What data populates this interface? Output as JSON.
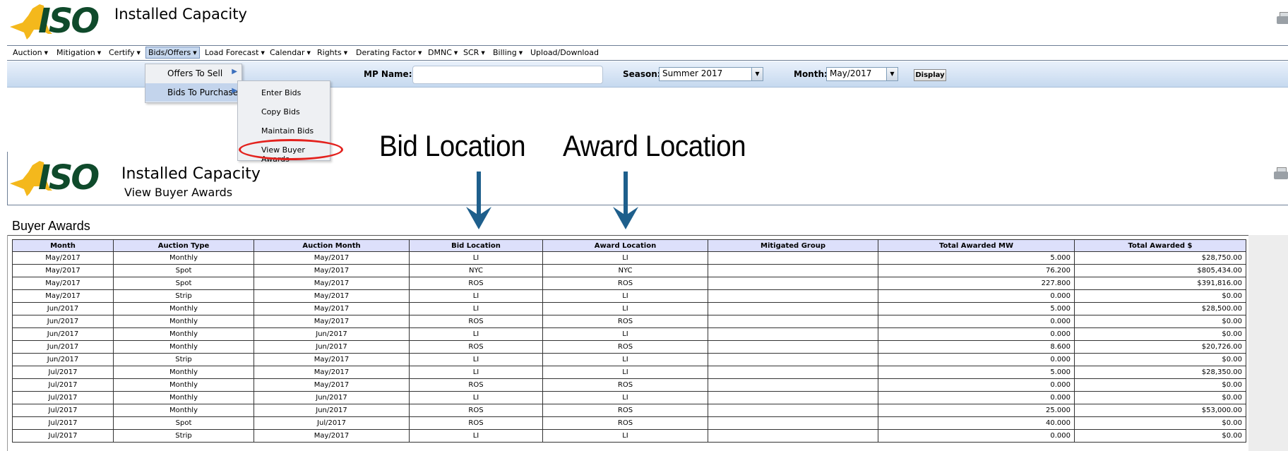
{
  "app": {
    "logo_text": "ISO",
    "title": "Installed Capacity"
  },
  "menu": [
    {
      "label": "Auction"
    },
    {
      "label": "Mitigation"
    },
    {
      "label": "Certify"
    },
    {
      "label": "Bids/Offers",
      "active": true
    },
    {
      "label": "Load Forecast"
    },
    {
      "label": "Calendar"
    },
    {
      "label": "Rights"
    },
    {
      "label": "Derating Factor"
    },
    {
      "label": "DMNC"
    },
    {
      "label": "SCR"
    },
    {
      "label": "Billing"
    },
    {
      "label": "Upload/Download"
    }
  ],
  "bids_menu": {
    "items": [
      "Offers To Sell",
      "Bids To Purchase"
    ],
    "purchase_submenu": [
      "Enter Bids",
      "Copy Bids",
      "Maintain Bids",
      "View Buyer Awards"
    ]
  },
  "filters": {
    "mp_name_label": "MP Name:",
    "mp_name_value": "",
    "season_label": "Season:",
    "season_value": "Summer 2017",
    "month_label": "Month:",
    "month_value": "May/2017",
    "display_label": "Display"
  },
  "annotations": {
    "bid_location": "Bid Location",
    "award_location": "Award Location",
    "arrow_color": "#1e5f8c"
  },
  "page": {
    "title": "Installed Capacity",
    "subtitle": "View Buyer Awards",
    "section_title": "Buyer Awards"
  },
  "table": {
    "columns": [
      "Month",
      "Auction Type",
      "Auction Month",
      "Bid Location",
      "Award Location",
      "Mitigated Group",
      "Total Awarded MW",
      "Total Awarded $"
    ],
    "rows": [
      [
        "May/2017",
        "Monthly",
        "May/2017",
        "LI",
        "LI",
        "",
        "5.000",
        "$28,750.00"
      ],
      [
        "May/2017",
        "Spot",
        "May/2017",
        "NYC",
        "NYC",
        "",
        "76.200",
        "$805,434.00"
      ],
      [
        "May/2017",
        "Spot",
        "May/2017",
        "ROS",
        "ROS",
        "",
        "227.800",
        "$391,816.00"
      ],
      [
        "May/2017",
        "Strip",
        "May/2017",
        "LI",
        "LI",
        "",
        "0.000",
        "$0.00"
      ],
      [
        "Jun/2017",
        "Monthly",
        "May/2017",
        "LI",
        "LI",
        "",
        "5.000",
        "$28,500.00"
      ],
      [
        "Jun/2017",
        "Monthly",
        "May/2017",
        "ROS",
        "ROS",
        "",
        "0.000",
        "$0.00"
      ],
      [
        "Jun/2017",
        "Monthly",
        "Jun/2017",
        "LI",
        "LI",
        "",
        "0.000",
        "$0.00"
      ],
      [
        "Jun/2017",
        "Monthly",
        "Jun/2017",
        "ROS",
        "ROS",
        "",
        "8.600",
        "$20,726.00"
      ],
      [
        "Jun/2017",
        "Strip",
        "May/2017",
        "LI",
        "LI",
        "",
        "0.000",
        "$0.00"
      ],
      [
        "Jul/2017",
        "Monthly",
        "May/2017",
        "LI",
        "LI",
        "",
        "5.000",
        "$28,350.00"
      ],
      [
        "Jul/2017",
        "Monthly",
        "May/2017",
        "ROS",
        "ROS",
        "",
        "0.000",
        "$0.00"
      ],
      [
        "Jul/2017",
        "Monthly",
        "Jun/2017",
        "LI",
        "LI",
        "",
        "0.000",
        "$0.00"
      ],
      [
        "Jul/2017",
        "Monthly",
        "Jun/2017",
        "ROS",
        "ROS",
        "",
        "25.000",
        "$53,000.00"
      ],
      [
        "Jul/2017",
        "Spot",
        "Jul/2017",
        "ROS",
        "ROS",
        "",
        "40.000",
        "$0.00"
      ],
      [
        "Jul/2017",
        "Strip",
        "May/2017",
        "LI",
        "LI",
        "",
        "0.000",
        "$0.00"
      ]
    ]
  },
  "colors": {
    "logo_green": "#0f4a2b",
    "state_yellow": "#f4b81c",
    "header_blue": "#dde0fb",
    "highlight_oval": "#e3221e"
  }
}
